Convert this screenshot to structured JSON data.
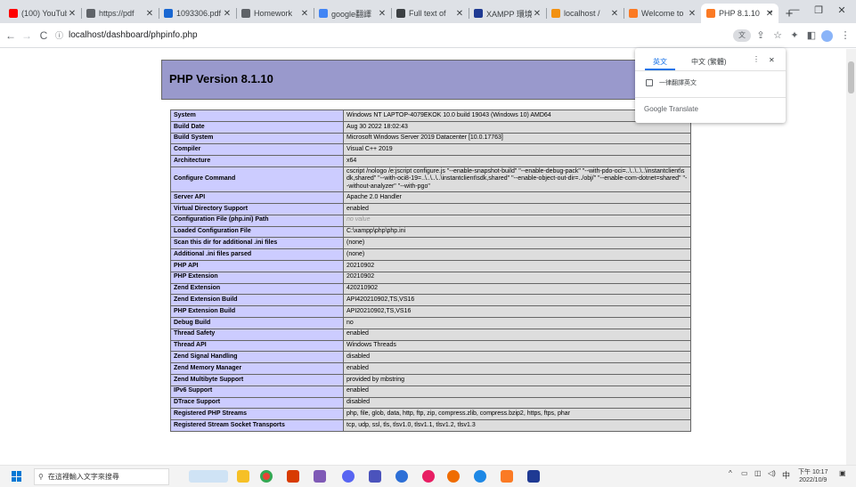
{
  "browser": {
    "tabs": [
      {
        "title": "(100) YouTube",
        "favicon": "youtube-icon",
        "color": "#ff0000"
      },
      {
        "title": "https://pdf",
        "favicon": "globe-icon",
        "color": "#5f6368"
      },
      {
        "title": "1093306.pdf",
        "favicon": "pdf-icon",
        "color": "#1967d2"
      },
      {
        "title": "Homework",
        "favicon": "globe-icon",
        "color": "#5f6368"
      },
      {
        "title": "google翻譯",
        "favicon": "google-icon",
        "color": "#4285f4"
      },
      {
        "title": "Full text of",
        "favicon": "document-icon",
        "color": "#3c4043"
      },
      {
        "title": "XAMPP 環境",
        "favicon": "xampp-icon",
        "color": "#1f3a93"
      },
      {
        "title": "localhost /",
        "favicon": "phpmyadmin-icon",
        "color": "#f29111"
      },
      {
        "title": "Welcome to",
        "favicon": "xampp-icon",
        "color": "#fb7a24"
      },
      {
        "title": "PHP 8.1.10",
        "favicon": "xampp-icon",
        "color": "#fb7a24",
        "active": true
      }
    ],
    "new_tab": "+",
    "url": "localhost/dashboard/phpinfo.php"
  },
  "page": {
    "title": "PHP Version 8.1.10",
    "rows": [
      {
        "key": "System",
        "value": "Windows NT LAPTOP-4079EKOK 10.0 build 19043 (Windows 10) AMD64"
      },
      {
        "key": "Build Date",
        "value": "Aug 30 2022 18:02:43"
      },
      {
        "key": "Build System",
        "value": "Microsoft Windows Server 2019 Datacenter [10.0.17763]"
      },
      {
        "key": "Compiler",
        "value": "Visual C++ 2019"
      },
      {
        "key": "Architecture",
        "value": "x64"
      },
      {
        "key": "Configure Command",
        "value": "cscript /nologo /e:jscript configure.js \"--enable-snapshot-build\" \"--enable-debug-pack\" \"--with-pdo-oci=..\\..\\..\\..\\instantclient\\sdk,shared\" \"--with-oci8-19=..\\..\\..\\..\\instantclient\\sdk,shared\" \"--enable-object-out-dir=../obj/\" \"--enable-com-dotnet=shared\" \"--without-analyzer\" \"--with-pgo\""
      },
      {
        "key": "Server API",
        "value": "Apache 2.0 Handler"
      },
      {
        "key": "Virtual Directory Support",
        "value": "enabled"
      },
      {
        "key": "Configuration File (php.ini) Path",
        "value": "no value",
        "italic": true
      },
      {
        "key": "Loaded Configuration File",
        "value": "C:\\xampp\\php\\php.ini"
      },
      {
        "key": "Scan this dir for additional .ini files",
        "value": "(none)"
      },
      {
        "key": "Additional .ini files parsed",
        "value": "(none)"
      },
      {
        "key": "PHP API",
        "value": "20210902"
      },
      {
        "key": "PHP Extension",
        "value": "20210902"
      },
      {
        "key": "Zend Extension",
        "value": "420210902"
      },
      {
        "key": "Zend Extension Build",
        "value": "API420210902,TS,VS16"
      },
      {
        "key": "PHP Extension Build",
        "value": "API20210902,TS,VS16"
      },
      {
        "key": "Debug Build",
        "value": "no"
      },
      {
        "key": "Thread Safety",
        "value": "enabled"
      },
      {
        "key": "Thread API",
        "value": "Windows Threads"
      },
      {
        "key": "Zend Signal Handling",
        "value": "disabled"
      },
      {
        "key": "Zend Memory Manager",
        "value": "enabled"
      },
      {
        "key": "Zend Multibyte Support",
        "value": "provided by mbstring"
      },
      {
        "key": "IPv6 Support",
        "value": "enabled"
      },
      {
        "key": "DTrace Support",
        "value": "disabled"
      },
      {
        "key": "Registered PHP Streams",
        "value": "php, file, glob, data, http, ftp, zip, compress.zlib, compress.bzip2, https, ftps, phar"
      },
      {
        "key": "Registered Stream Socket Transports",
        "value": "tcp, udp, ssl, tls, tlsv1.0, tlsv1.1, tlsv1.2, tlsv1.3"
      }
    ]
  },
  "translate_popup": {
    "source_lang": "英文",
    "target_lang": "中文 (繁體)",
    "always_translate": "一律翻譯英文",
    "brand": "Google Translate"
  },
  "taskbar": {
    "search_placeholder": "在這裡輸入文字來搜尋",
    "ime": "中",
    "time": "下午 10:17",
    "date": "2022/10/9"
  },
  "colors": {
    "php_header": "#9999cc",
    "key_cell": "#ccccff",
    "value_cell": "#dddddd",
    "accent": "#1a73e8"
  }
}
